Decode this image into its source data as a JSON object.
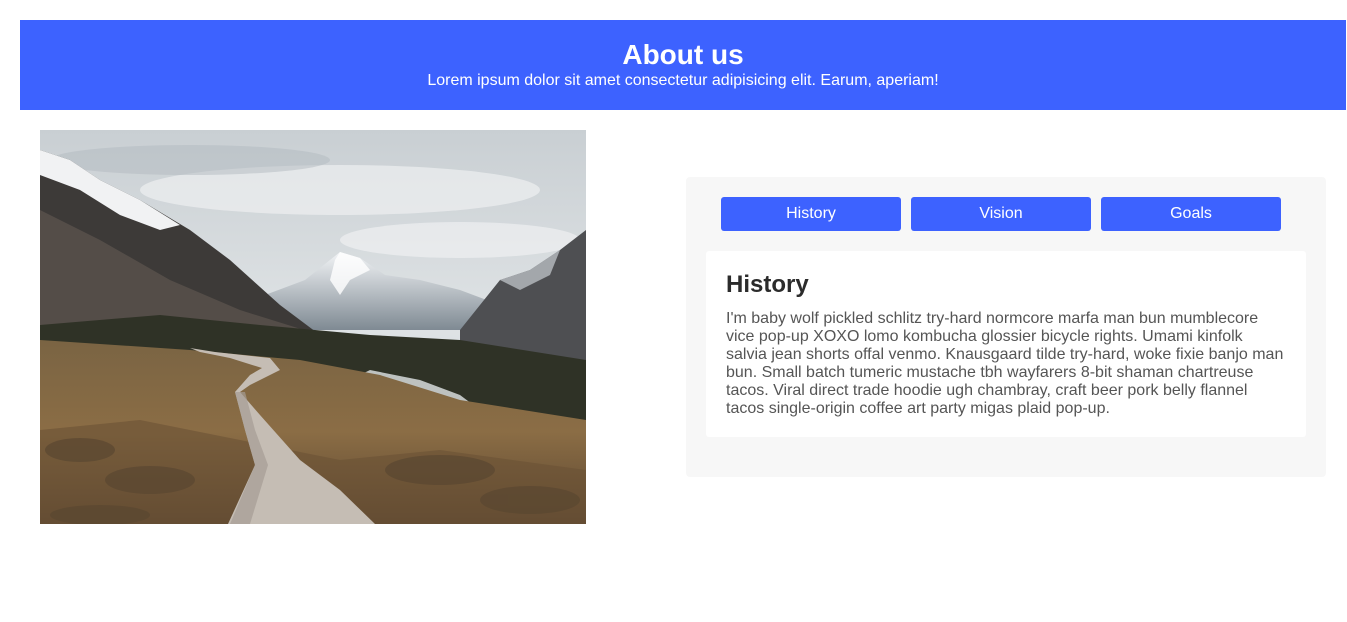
{
  "header": {
    "title": "About us",
    "subtitle": "Lorem ipsum dolor sit amet consectetur adipisicing elit. Earum, aperiam!"
  },
  "photo": {
    "subject": "mountain-valley-boardwalk-photo"
  },
  "tabs": [
    {
      "label": "History"
    },
    {
      "label": "Vision"
    },
    {
      "label": "Goals"
    }
  ],
  "content": {
    "title": "History",
    "body": "I'm baby wolf pickled schlitz try-hard normcore marfa man bun mumblecore vice pop-up XOXO lomo kombucha glossier bicycle rights. Umami kinfolk salvia jean shorts offal venmo. Knausgaard tilde try-hard, woke fixie banjo man bun. Small batch tumeric mustache tbh wayfarers 8-bit shaman chartreuse tacos. Viral direct trade hoodie ugh chambray, craft beer pork belly flannel tacos single-origin coffee art party migas plaid pop-up."
  },
  "colors": {
    "accent": "#3d62ff",
    "panel_bg": "#f7f7f7",
    "content_bg": "#ffffff"
  }
}
